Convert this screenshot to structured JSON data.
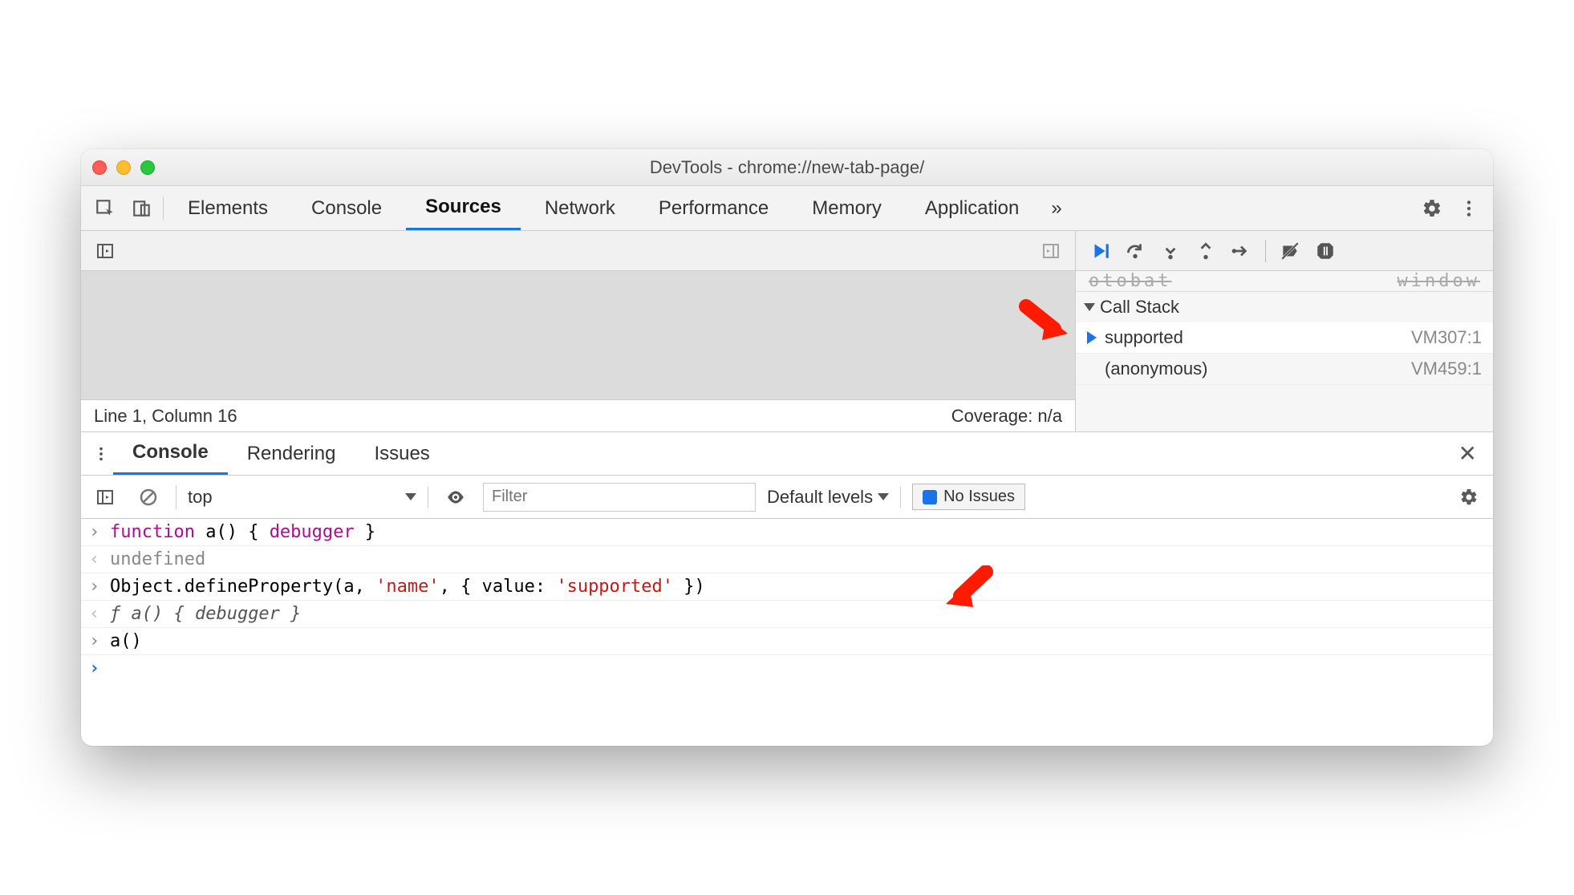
{
  "window": {
    "title": "DevTools - chrome://new-tab-page/"
  },
  "tabs": {
    "items": [
      "Elements",
      "Console",
      "Sources",
      "Network",
      "Performance",
      "Memory",
      "Application"
    ],
    "active_index": 2
  },
  "editor_status": {
    "position": "Line 1, Column 16",
    "coverage": "Coverage: n/a"
  },
  "call_stack": {
    "title": "Call Stack",
    "frames": [
      {
        "name": "supported",
        "location": "VM307:1",
        "current": true
      },
      {
        "name": "(anonymous)",
        "location": "VM459:1",
        "current": false
      }
    ]
  },
  "drawer": {
    "tabs": [
      "Console",
      "Rendering",
      "Issues"
    ],
    "active_index": 0
  },
  "console_toolbar": {
    "context": "top",
    "filter_placeholder": "Filter",
    "levels": "Default levels",
    "issues": "No Issues"
  },
  "console_lines": {
    "l0_pre": "function",
    "l0_mid": " a() { ",
    "l0_kw2": "debugger",
    "l0_post": " }",
    "l1": "undefined",
    "l2_pre": "Object.defineProperty(a, ",
    "l2_s1": "'name'",
    "l2_mid": ", { value: ",
    "l2_s2": "'supported'",
    "l2_post": " })",
    "l3_sym": "ƒ",
    "l3_body": " a() { debugger }",
    "l4": "a()"
  }
}
